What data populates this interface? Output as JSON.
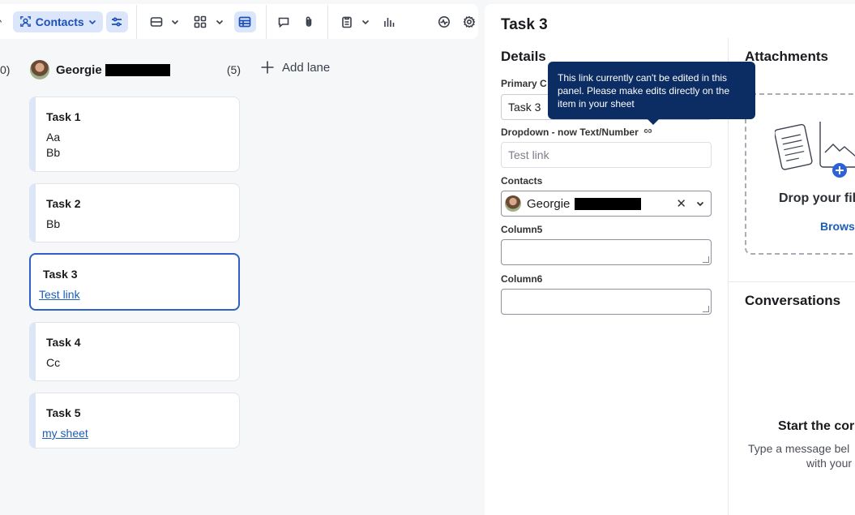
{
  "toolbar": {
    "contacts_label": "Contacts"
  },
  "board": {
    "left_lane_count_partial": "0)",
    "lane": {
      "name": "Georgie",
      "count": "(5)"
    },
    "add_lane_label": "Add lane",
    "cards": [
      {
        "title": "Task 1",
        "lines": [
          "Aa",
          "Bb"
        ]
      },
      {
        "title": "Task 2",
        "lines": [
          "Bb"
        ]
      },
      {
        "title": "Task 3",
        "link": "Test link",
        "selected": true
      },
      {
        "title": "Task 4",
        "lines": [
          "Cc"
        ]
      },
      {
        "title": "Task 5",
        "link": "my sheet"
      }
    ]
  },
  "panel": {
    "title": "Task 3",
    "details_heading": "Details",
    "fields": {
      "primary_label": "Primary C",
      "primary_value": "Task 3",
      "dropdown_label": "Dropdown - now Text/Number",
      "dropdown_placeholder": "Test link",
      "contacts_label": "Contacts",
      "contacts_value": "Georgie",
      "column5_label": "Column5",
      "column6_label": "Column6"
    },
    "tooltip": "This link currently can't be edited in this panel. Please make edits directly on the item in your sheet",
    "attachments": {
      "heading": "Attachments",
      "drop_text": "Drop your fil",
      "browse_label": "Browse"
    },
    "conversations": {
      "heading": "Conversations",
      "start_text": "Start the cor",
      "type_text": "Type a message bel",
      "with_text": "with your"
    }
  },
  "colors": {
    "accent": "#2f5fc9",
    "pill_bg": "#dbe6fb",
    "tooltip_bg": "#0b2d63",
    "link": "#1d5db5"
  }
}
